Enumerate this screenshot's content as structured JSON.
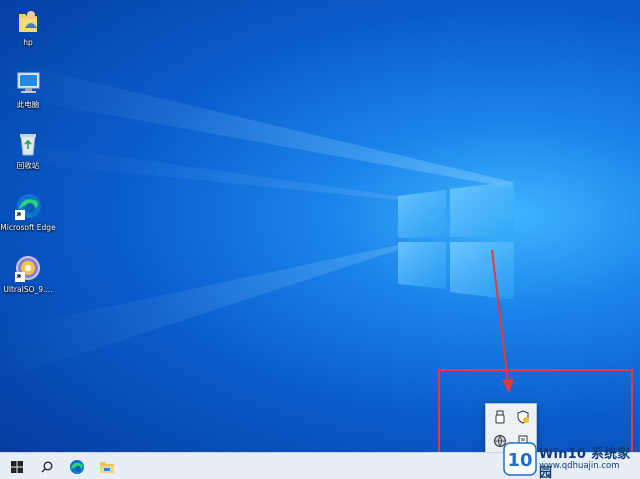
{
  "desktop": {
    "icons": [
      {
        "label": "hp",
        "icon": "user-folder-icon"
      },
      {
        "label": "此电脑",
        "icon": "computer-icon"
      },
      {
        "label": "回收站",
        "icon": "recycle-bin-icon"
      },
      {
        "label": "Microsoft Edge",
        "icon": "edge-icon"
      },
      {
        "label": "UltraISO_9....",
        "icon": "ultraiso-icon"
      }
    ]
  },
  "taskbar": {
    "buttons": [
      {
        "icon": "windows-start-icon"
      },
      {
        "icon": "search-icon"
      },
      {
        "icon": "edge-icon"
      },
      {
        "icon": "file-explorer-icon"
      }
    ]
  },
  "tray_popup": {
    "icons": [
      "usb-drive-icon",
      "security-shield-icon",
      "network-globe-icon",
      "device-icon"
    ]
  },
  "annotation": {
    "arrow_color": "#e33a3a",
    "box_color": "#e33a3a"
  },
  "watermark": {
    "logo_text": "10",
    "title": "Win10 系统家园",
    "url": "www.qdhuajin.com"
  }
}
